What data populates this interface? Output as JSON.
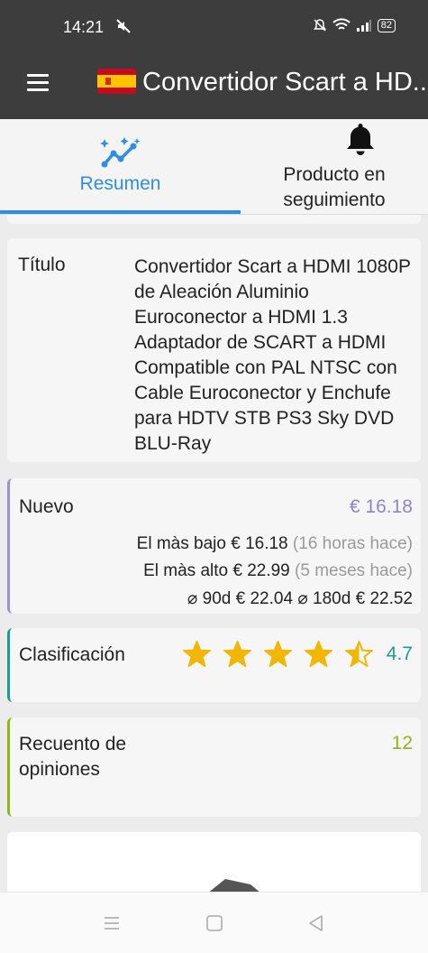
{
  "status_bar": {
    "time": "14:21",
    "battery": "82"
  },
  "app_bar": {
    "title": "Convertidor Scart a HD..."
  },
  "tabs": [
    {
      "label": "Resumen"
    },
    {
      "label": "Producto en seguimiento"
    }
  ],
  "title_card": {
    "label": "Título",
    "value": "Convertidor Scart a HDMI 1080P de Aleación Aluminio Euroconector a HDMI 1.3 Adaptador de SCART a HDMI Compatible con PAL NTSC con Cable Euroconector y Enchufe para HDTV STB PS3 Sky DVD BLU-Ray"
  },
  "price_card": {
    "label": "Nuevo",
    "current": "€ 16.18",
    "lowest_label": "El màs bajo",
    "lowest_value": "€ 16.18",
    "lowest_when": "(16 horas hace)",
    "highest_label": "El màs alto",
    "highest_value": "€ 22.99",
    "highest_when": "(5 meses hace)",
    "avg90_label": "⌀ 90d",
    "avg90_value": "€ 22.04",
    "avg180_label": "⌀ 180d",
    "avg180_value": "€ 22.52"
  },
  "rating_card": {
    "label": "Clasificación",
    "value": "4.7",
    "stars": 4.7
  },
  "count_card": {
    "label": "Recuento de opiniones",
    "value": "12"
  },
  "colors": {
    "app_bar": "#3d3d3d",
    "accent_blue": "#2f8ee0",
    "price_purple": "#8f86c9",
    "rating_teal": "#1e9b8c",
    "count_green": "#8fb51d",
    "star_gold": "#f2b705"
  },
  "icons": {
    "menu": "menu-icon",
    "flag": "spain-flag-icon",
    "summary": "trending-sparkle-icon",
    "tracking": "bell-icon",
    "nav": [
      "recent-apps-icon",
      "home-icon",
      "back-icon"
    ]
  }
}
